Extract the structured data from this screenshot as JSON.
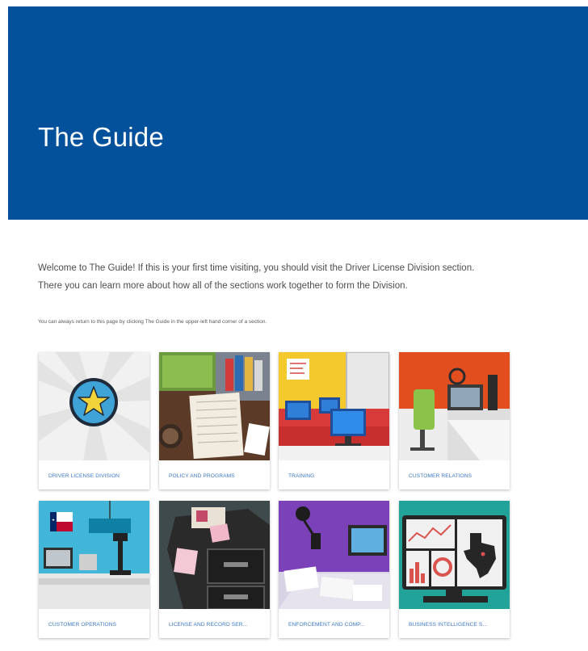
{
  "header": {
    "title": "The Guide",
    "background_color": "#03519a"
  },
  "intro": {
    "line1": "Welcome to The Guide! If this is your first time visiting, you should visit the Driver License Division section.",
    "line2": "There you can learn more about how all of the sections work together to form the Division.",
    "note": "You can always return to this page by clicking The Guide in the upper-left hand corner of a section."
  },
  "sections": [
    {
      "label": "Driver License Division",
      "icon": "star-badge-icon"
    },
    {
      "label": "Policy and Programs",
      "icon": "desk-documents-illustration"
    },
    {
      "label": "Training",
      "icon": "classroom-computers-illustration"
    },
    {
      "label": "Customer Relations",
      "icon": "headset-office-illustration"
    },
    {
      "label": "Customer Operations",
      "icon": "service-counter-illustration"
    },
    {
      "label": "License and Record Ser...",
      "icon": "file-cabinet-illustration"
    },
    {
      "label": "Enforcement and Comp...",
      "icon": "investigation-desk-illustration"
    },
    {
      "label": "Business Intelligence S...",
      "icon": "dashboard-map-illustration"
    }
  ],
  "colors": {
    "accent_link": "#3a77c8",
    "text": "#4d4d4d"
  }
}
